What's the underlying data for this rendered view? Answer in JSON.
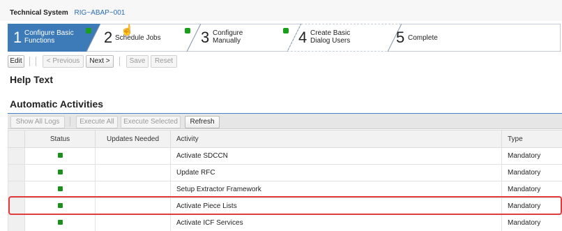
{
  "header": {
    "tech_label": "Technical System",
    "tech_value": "RIG~ABAP~001"
  },
  "steps": [
    {
      "num": "1",
      "line1": "Configure Basic",
      "line2": "Functions",
      "active": true,
      "done": true
    },
    {
      "num": "2",
      "line1": "Schedule Jobs",
      "line2": "",
      "active": false,
      "done": true
    },
    {
      "num": "3",
      "line1": "Configure",
      "line2": "Manually",
      "active": false,
      "done": true
    },
    {
      "num": "4",
      "line1": "Create Basic",
      "line2": "Dialog Users",
      "active": false,
      "done": false
    },
    {
      "num": "5",
      "line1": "Complete",
      "line2": "",
      "active": false,
      "done": false
    }
  ],
  "toolbar": {
    "edit": "Edit",
    "previous": "< Previous",
    "next": "Next >",
    "save": "Save",
    "reset": "Reset"
  },
  "help_title": "Help Text",
  "section_title": "Automatic Activities",
  "activity_toolbar": {
    "show_logs": "Show All Logs",
    "execute_all": "Execute All",
    "execute_selected": "Execute Selected",
    "refresh": "Refresh"
  },
  "table": {
    "columns": [
      "Status",
      "Updates Needed",
      "Activity",
      "Type"
    ],
    "rows": [
      {
        "status": "green",
        "updates": "",
        "activity": "Activate SDCCN",
        "type": "Mandatory"
      },
      {
        "status": "green",
        "updates": "",
        "activity": "Update RFC",
        "type": "Mandatory"
      },
      {
        "status": "green",
        "updates": "",
        "activity": "Setup Extractor Framework",
        "type": "Mandatory"
      },
      {
        "status": "green",
        "updates": "",
        "activity": "Activate Piece Lists",
        "type": "Mandatory"
      },
      {
        "status": "green",
        "updates": "",
        "activity": "Activate ICF Services",
        "type": "Mandatory"
      }
    ]
  },
  "colors": {
    "accent": "#3f86c7",
    "active_step": "#3d7ab8",
    "status_green": "#1c8f1c",
    "highlight": "#e03c3c"
  }
}
